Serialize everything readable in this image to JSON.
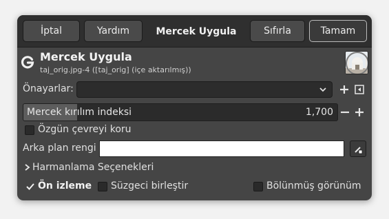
{
  "header": {
    "cancel_label": "İptal",
    "help_label": "Yardım",
    "title": "Mercek Uygula",
    "reset_label": "Sıfırla",
    "ok_label": "Tamam"
  },
  "plugin": {
    "title": "Mercek Uygula",
    "subtitle": "taj_orig.jpg-4 ([taj_orig] (içe aktarılmış))"
  },
  "presets": {
    "label": "Önayarlar:",
    "selected": ""
  },
  "refraction": {
    "label": "Mercek kırılım indeksi",
    "value": "1,700",
    "fill_fraction": 0.17
  },
  "keep_surroundings": {
    "label": "Özgün çevreyi koru",
    "checked": false
  },
  "background_color": {
    "label": "Arka plan rengi",
    "value": "#ffffff"
  },
  "blending": {
    "label": "Harmanlama Seçenekleri"
  },
  "footer": {
    "preview_label": "Ön izleme",
    "preview_checked": true,
    "merge_label": "Süzgeci birleştir",
    "merge_checked": false,
    "split_label": "Bölünmüş görünüm",
    "split_checked": false
  },
  "colors": {
    "accent": "#dcdcdc",
    "dialog_bg": "#454545",
    "header_bg": "#2f2f2f"
  }
}
